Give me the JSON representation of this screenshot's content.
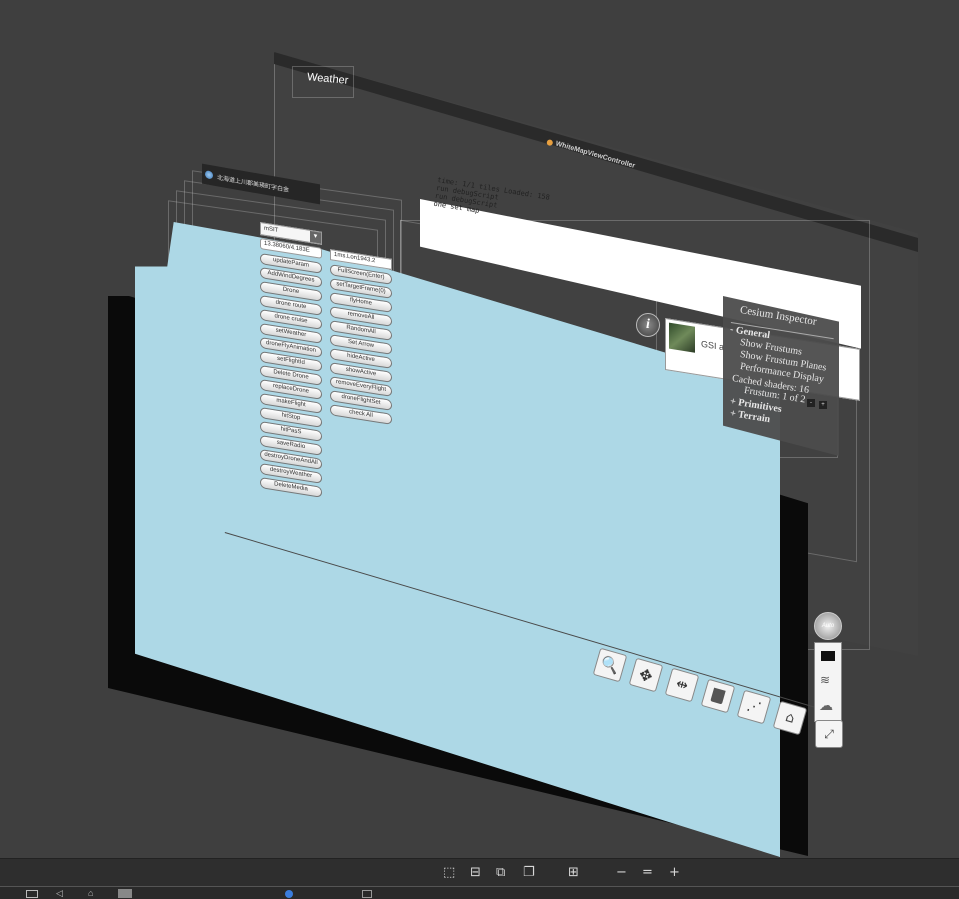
{
  "hierarchy": {
    "weather_label": "Weather",
    "controller_title": "WhiteMapViewController",
    "window_title": "北海道上川郡美瑛町字白金"
  },
  "log_panel": {
    "lines": [
      "time: 1/1 tiles Loaded: 158",
      "run debugScript",
      "run debugScript",
      "one set map"
    ]
  },
  "controls": {
    "select_value": "mSIT",
    "field_left": "13.38060/4.183E",
    "field_right": "1ms.Lon1943.2",
    "left_buttons": [
      "updateParam",
      "AddWindDegrees",
      "Drone",
      "drone route",
      "drone cruise",
      "setWeather",
      "droneFlyAnimation",
      "setFlightId",
      "Delete Drone",
      "replaceDrone",
      "makeFlight",
      "hitStop",
      "hitPasS",
      "saveRadio",
      "destroyDroneAndAll",
      "destroyWeather",
      "DeleteMedia"
    ],
    "right_buttons": [
      "FullScreen(Enter)",
      "setTargetFrame(0)",
      "flyHome",
      "removeAll",
      "RandomAll",
      "Set Arrow",
      "hideActive",
      "showActive",
      "removeEveryFlight",
      "droneFlightSet",
      "check All"
    ]
  },
  "info_bar": {
    "info_label": "i",
    "imagery_label": "GSI a"
  },
  "inspector": {
    "title": "Cesium Inspector",
    "general": "- General",
    "show_frustums": "Show Frustums",
    "show_frustum_planes": "Show Frustum Planes",
    "performance_display": "Performance Display",
    "cached_shaders": "Cached shaders: 16",
    "frustum": "Frustum: 1 of 2",
    "primitives": "+ Primitives",
    "terrain": "+ Terrain"
  },
  "side_widgets": {
    "auto_label": "Auto"
  },
  "colors": {
    "background": "#3f3f3f",
    "canvas": "#add8e6",
    "inspector_bg": "#4c4c4c"
  }
}
